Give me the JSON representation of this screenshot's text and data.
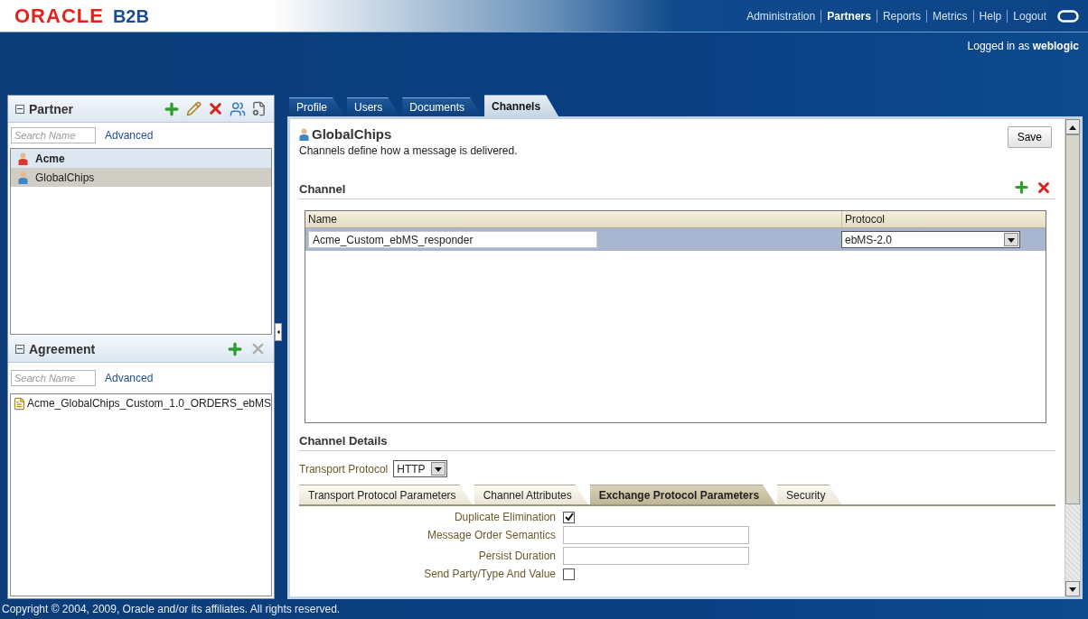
{
  "header": {
    "logo": "ORACLE",
    "product": "B2B",
    "nav": [
      {
        "label": "Administration",
        "selected": false
      },
      {
        "label": "Partners",
        "selected": true
      },
      {
        "label": "Reports",
        "selected": false
      },
      {
        "label": "Metrics",
        "selected": false
      },
      {
        "label": "Help",
        "selected": false
      },
      {
        "label": "Logout",
        "selected": false
      }
    ],
    "logged_in_prefix": "Logged in as",
    "user": "weblogic"
  },
  "partner_panel": {
    "title": "Partner",
    "search_placeholder": "Search Name",
    "advanced": "Advanced",
    "items": [
      {
        "name": "Acme",
        "host": true,
        "selected": false,
        "color": "#d83a2e"
      },
      {
        "name": "GlobalChips",
        "host": false,
        "selected": true,
        "color": "#3f86c9"
      }
    ]
  },
  "agreement_panel": {
    "title": "Agreement",
    "search_placeholder": "Search Name",
    "advanced": "Advanced",
    "items": [
      {
        "name": "Acme_GlobalChips_Custom_1.0_ORDERS_ebMS"
      }
    ]
  },
  "tabs": [
    {
      "label": "Profile",
      "selected": false
    },
    {
      "label": "Users",
      "selected": false
    },
    {
      "label": "Documents",
      "selected": false
    },
    {
      "label": "Channels",
      "selected": true
    }
  ],
  "partner": {
    "name": "GlobalChips",
    "description": "Channels define how a message is delivered."
  },
  "save": "Save",
  "channel": {
    "title": "Channel",
    "columns": [
      "Name",
      "Protocol"
    ],
    "rows": [
      {
        "name": "Acme_Custom_ebMS_responder",
        "protocol": "ebMS-2.0",
        "selected": true
      }
    ]
  },
  "details": {
    "title": "Channel Details",
    "transport_label": "Transport Protocol",
    "transport_value": "HTTP",
    "tabs": [
      {
        "label": "Transport Protocol Parameters",
        "selected": false
      },
      {
        "label": "Channel Attributes",
        "selected": false
      },
      {
        "label": "Exchange Protocol Parameters",
        "selected": true
      },
      {
        "label": "Security",
        "selected": false
      }
    ],
    "fields": [
      {
        "kind": "checkbox",
        "label": "Duplicate Elimination",
        "checked": true
      },
      {
        "kind": "text",
        "label": "Message Order Semantics"
      },
      {
        "kind": "text",
        "label": "Persist Duration"
      },
      {
        "kind": "checkbox",
        "label": "Send Party/Type And Value",
        "checked": false
      }
    ]
  },
  "footer": "Copyright © 2004, 2009, Oracle and/or its affiliates. All rights reserved."
}
